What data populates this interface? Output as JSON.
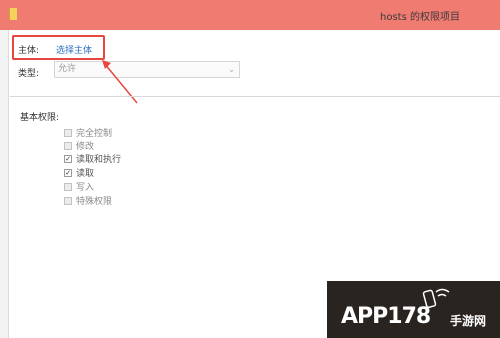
{
  "window": {
    "title": "hosts 的权限项目"
  },
  "principal": {
    "label": "主体:",
    "link": "选择主体"
  },
  "type": {
    "label": "类型:",
    "value": "允许"
  },
  "basic_permissions": {
    "label": "基本权限:",
    "items": [
      {
        "label": "完全控制",
        "checked": false
      },
      {
        "label": "修改",
        "checked": false
      },
      {
        "label": "读取和执行",
        "checked": true
      },
      {
        "label": "读取",
        "checked": true
      },
      {
        "label": "写入",
        "checked": false
      },
      {
        "label": "特殊权限",
        "checked": false
      }
    ]
  },
  "watermark": {
    "text": "APP178",
    "sub": "手游网"
  },
  "colors": {
    "titlebar": "#f07b70",
    "highlight": "#e8453c",
    "link": "#2f6fc3"
  }
}
